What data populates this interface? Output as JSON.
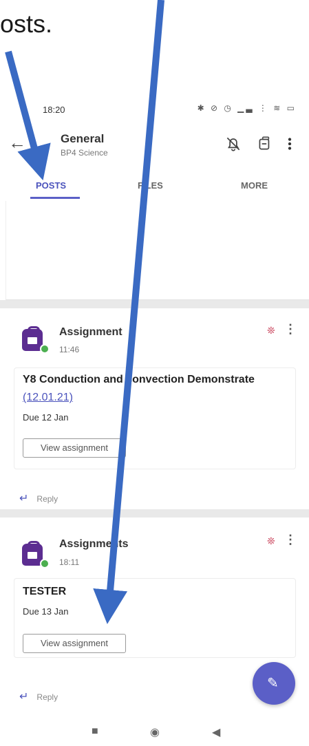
{
  "caption": "osts.",
  "status": {
    "time": "18:20",
    "icons": "✱ ⊘ ◷ ▁▃ ⋮ ≋ ▭"
  },
  "header": {
    "back_icon": "arrow-left-icon",
    "title": "General",
    "subtitle": "BP4 Science",
    "icons": [
      "bell-off-icon",
      "meeting-icon",
      "overflow-menu-icon"
    ]
  },
  "tabs": [
    {
      "label": "POSTS",
      "active": true
    },
    {
      "label": "FILES",
      "active": false
    },
    {
      "label": "MORE",
      "active": false
    }
  ],
  "posts": [
    {
      "author": "Assignment",
      "time": "11:46",
      "card_title": "Y8 Conduction and convection Demonstrate",
      "card_link": "(12.01.21)",
      "due": "Due 12 Jan",
      "button": "View assignment",
      "reply": "Reply"
    },
    {
      "author": "Assignments",
      "time": "18:11",
      "card_title": "TESTER",
      "due": "Due 13 Jan",
      "button": "View assignment",
      "reply": "Reply"
    }
  ],
  "fab_icon": "compose-icon",
  "navbar": {
    "icons": [
      "square-icon",
      "circle-icon",
      "triangle-back-icon"
    ]
  },
  "colors": {
    "accent": "#5b5fc7",
    "arrow": "#3a6ac3",
    "avatar": "#5c2d91"
  }
}
